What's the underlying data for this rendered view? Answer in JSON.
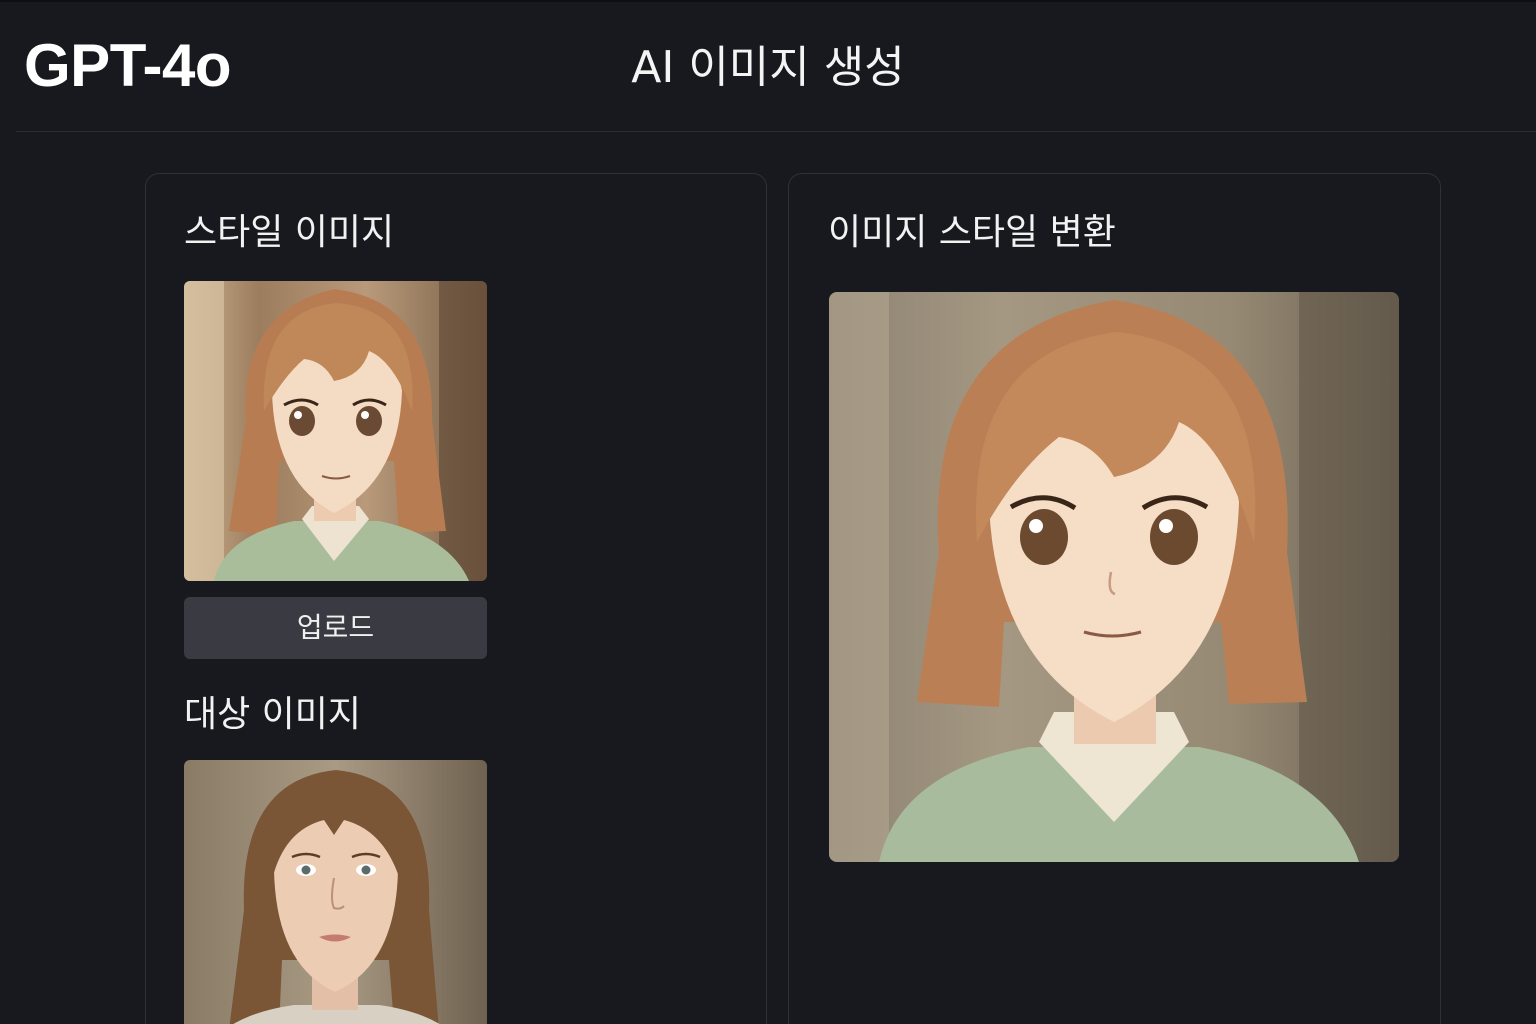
{
  "header": {
    "logo": "GPT-4o",
    "title": "AI 이미지 생성"
  },
  "left_panel": {
    "style_section": {
      "heading": "스타일 이미지",
      "upload_label": "업로드"
    },
    "target_section": {
      "heading": "대상 이미지"
    }
  },
  "right_panel": {
    "heading": "이미지 스타일 변환"
  },
  "colors": {
    "background": "#18191e",
    "card_border": "#2f3138",
    "button": "#3a3b42",
    "text": "#f2f2f2"
  }
}
